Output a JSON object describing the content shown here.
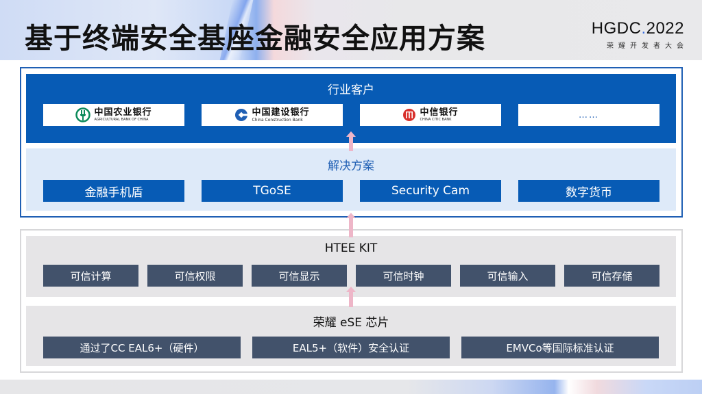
{
  "header": {
    "title": "基于终端安全基座金融安全应用方案",
    "brand": {
      "name": "HGDC",
      "dot": ".",
      "year": "2022",
      "subtitle": "荣耀开发者大会"
    }
  },
  "customers": {
    "title": "行业客户",
    "banks": [
      {
        "name_cn": "中国农业银行",
        "name_en": "AGRICULTURAL BANK OF CHINA",
        "logo_icon": "abc-logo-icon",
        "logo_color": "#0b8a5a"
      },
      {
        "name_cn": "中国建设银行",
        "name_en": "China Construction Bank",
        "logo_icon": "ccb-logo-icon",
        "logo_color": "#1f5fb4"
      },
      {
        "name_cn": "中信银行",
        "name_en": "CHINA CITIC BANK",
        "logo_icon": "citic-logo-icon",
        "logo_color": "#d8302c"
      },
      {
        "name_cn": "……",
        "name_en": ""
      }
    ]
  },
  "solutions": {
    "title": "解决方案",
    "items": [
      "金融手机盾",
      "TGoSE",
      "Security Cam",
      "数字货币"
    ]
  },
  "htee_kit": {
    "title": "HTEE KIT",
    "items": [
      "可信计算",
      "可信权限",
      "可信显示",
      "可信时钟",
      "可信输入",
      "可信存储"
    ]
  },
  "ese_chip": {
    "title": "荣耀 eSE 芯片",
    "items": [
      "通过了CC EAL6+（硬件）",
      "EAL5+（软件）安全认证",
      "EMVCo等国际标准认证"
    ]
  },
  "colors": {
    "primary_blue": "#075bb5",
    "light_blue": "#deeaf9",
    "slate": "#42526b",
    "gray_panel": "#e6e5e7",
    "arrow_pink": "#eeb6c8"
  }
}
